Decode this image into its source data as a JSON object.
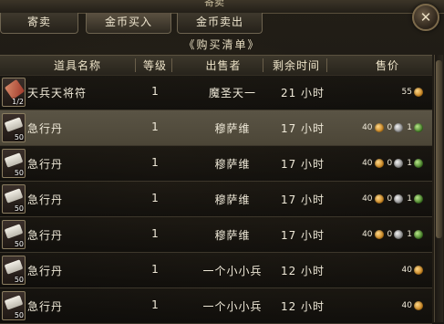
{
  "window": {
    "title": "寄卖",
    "close_glyph": "✕"
  },
  "tabs": [
    {
      "label": "寄卖",
      "active": false
    },
    {
      "label": "金币买入",
      "active": true
    },
    {
      "label": "金币卖出",
      "active": false
    }
  ],
  "list_title": "《购买清单》",
  "columns": {
    "name": "道具名称",
    "level": "等级",
    "seller": "出售者",
    "time": "剩余时间",
    "price": "售价"
  },
  "rows": [
    {
      "icon": "talisman-icon",
      "qty": "1/2",
      "name": "天兵天将符",
      "level": "1",
      "seller": "魔圣天一",
      "time": "21 小时",
      "price": {
        "gold": "55",
        "silver": "",
        "jade": ""
      },
      "selected": false
    },
    {
      "icon": "scroll-icon",
      "qty": "50",
      "name": "急行丹",
      "level": "1",
      "seller": "穆萨维",
      "time": "17 小时",
      "price": {
        "gold": "40",
        "silver": "0",
        "jade": "1"
      },
      "selected": true
    },
    {
      "icon": "scroll-icon",
      "qty": "50",
      "name": "急行丹",
      "level": "1",
      "seller": "穆萨维",
      "time": "17 小时",
      "price": {
        "gold": "40",
        "silver": "0",
        "jade": "1"
      },
      "selected": false
    },
    {
      "icon": "scroll-icon",
      "qty": "50",
      "name": "急行丹",
      "level": "1",
      "seller": "穆萨维",
      "time": "17 小时",
      "price": {
        "gold": "40",
        "silver": "0",
        "jade": "1"
      },
      "selected": false
    },
    {
      "icon": "scroll-icon",
      "qty": "50",
      "name": "急行丹",
      "level": "1",
      "seller": "穆萨维",
      "time": "17 小时",
      "price": {
        "gold": "40",
        "silver": "0",
        "jade": "1"
      },
      "selected": false
    },
    {
      "icon": "scroll-icon",
      "qty": "50",
      "name": "急行丹",
      "level": "1",
      "seller": "一个小小兵",
      "time": "12 小时",
      "price": {
        "gold": "40",
        "silver": "",
        "jade": ""
      },
      "selected": false
    },
    {
      "icon": "scroll-icon",
      "qty": "50",
      "name": "急行丹",
      "level": "1",
      "seller": "一个小小兵",
      "time": "12 小时",
      "price": {
        "gold": "40",
        "silver": "",
        "jade": ""
      },
      "selected": false
    }
  ],
  "colors": {
    "gold_coin": "#d99a2b",
    "silver_coin": "#bdbdbd",
    "jade_coin": "#5e9a3a"
  }
}
